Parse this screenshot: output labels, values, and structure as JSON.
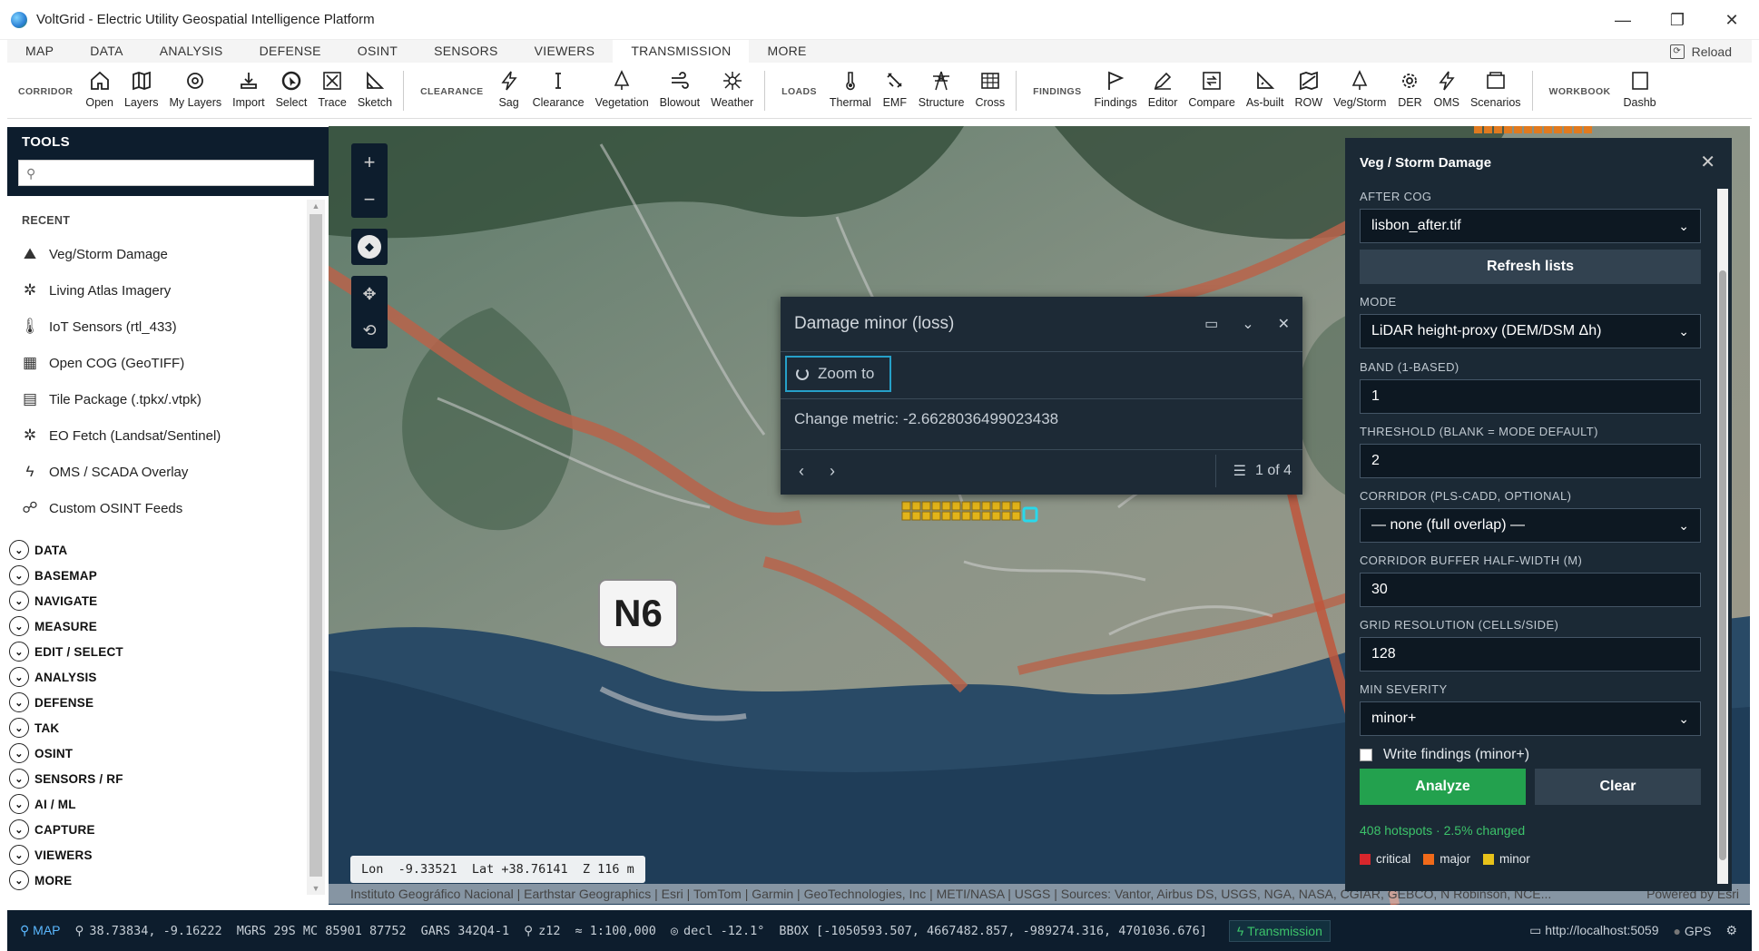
{
  "window": {
    "title": "VoltGrid - Electric Utility Geospatial Intelligence Platform",
    "minimize": "—",
    "restore": "❐",
    "close": "✕"
  },
  "menu": {
    "items": [
      "MAP",
      "DATA",
      "ANALYSIS",
      "DEFENSE",
      "OSINT",
      "SENSORS",
      "VIEWERS",
      "TRANSMISSION",
      "MORE"
    ],
    "active": "TRANSMISSION",
    "reload": "Reload"
  },
  "toolbar": {
    "corridor_label": "CORRIDOR",
    "corridor": [
      "Open",
      "Layers",
      "My Layers",
      "Import",
      "Select",
      "Trace",
      "Sketch"
    ],
    "clearance_label": "CLEARANCE",
    "clearance": [
      "Sag",
      "Clearance",
      "Vegetation",
      "Blowout",
      "Weather"
    ],
    "loads_label": "LOADS",
    "loads": [
      "Thermal",
      "EMF",
      "Structure",
      "Cross"
    ],
    "findings_label": "FINDINGS",
    "findings": [
      "Findings",
      "Editor",
      "Compare",
      "As-built",
      "ROW",
      "Veg/Storm",
      "DER",
      "OMS",
      "Scenarios"
    ],
    "workbook_label": "WORKBOOK",
    "workbook": [
      "Dashb"
    ]
  },
  "sidebar": {
    "title": "TOOLS",
    "search_placeholder": "",
    "recent_label": "RECENT",
    "recent": [
      {
        "label": "Veg/Storm Damage",
        "icon": "tree-icon"
      },
      {
        "label": "Living Atlas Imagery",
        "icon": "satellite-icon"
      },
      {
        "label": "IoT Sensors (rtl_433)",
        "icon": "thermometer-icon"
      },
      {
        "label": "Open COG (GeoTIFF)",
        "icon": "map-icon"
      },
      {
        "label": "Tile Package (.tpkx/.vtpk)",
        "icon": "package-map-icon"
      },
      {
        "label": "EO Fetch (Landsat/Sentinel)",
        "icon": "satellite-icon"
      },
      {
        "label": "OMS / SCADA Overlay",
        "icon": "bolt-icon"
      },
      {
        "label": "Custom OSINT Feeds",
        "icon": "feed-icon"
      }
    ],
    "categories": [
      "DATA",
      "BASEMAP",
      "NAVIGATE",
      "MEASURE",
      "EDIT / SELECT",
      "ANALYSIS",
      "DEFENSE",
      "TAK",
      "OSINT",
      "SENSORS / RF",
      "AI / ML",
      "CAPTURE",
      "VIEWERS",
      "MORE"
    ]
  },
  "map": {
    "road_label": "N6",
    "attribution": "Instituto Geográfico Nacional | Earthstar Geographics | Esri | TomTom | Garmin | GeoTechnologies, Inc | METI/NASA | USGS | Sources: Vantor, Airbus DS, USGS, NGA, NASA, CGIAR, GEBCO, N Robinson, NCE...",
    "powered_by": "Powered by Esri",
    "readout": "Lon  -9.33521  Lat +38.76141  Z 116 m",
    "zoom_in": "+",
    "zoom_out": "−"
  },
  "popup": {
    "title": "Damage minor (loss)",
    "zoom_to": "Zoom to",
    "metric": "Change metric: -2.6628036499023438",
    "count": "1 of 4",
    "prev": "‹",
    "next": "›"
  },
  "panel": {
    "title": "Veg / Storm Damage",
    "after_cog_label": "AFTER COG",
    "after_cog_value": "lisbon_after.tif",
    "refresh_label": "Refresh lists",
    "mode_label": "MODE",
    "mode_value": "LiDAR height-proxy (DEM/DSM Δh)",
    "band_label": "BAND (1-BASED)",
    "band_value": "1",
    "threshold_label": "THRESHOLD (BLANK = MODE DEFAULT)",
    "threshold_value": "2",
    "corridor_label": "CORRIDOR (PLS-CADD, OPTIONAL)",
    "corridor_value": "— none (full overlap) —",
    "buffer_label": "CORRIDOR BUFFER HALF-WIDTH (M)",
    "buffer_value": "30",
    "grid_label": "GRID RESOLUTION (CELLS/SIDE)",
    "grid_value": "128",
    "severity_label": "MIN SEVERITY",
    "severity_value": "minor+",
    "write_label": "Write findings (minor+)",
    "analyze_label": "Analyze",
    "clear_label": "Clear",
    "status": "408 hotspots · 2.5% changed",
    "legend": [
      {
        "label": "critical",
        "color": "#d8262c"
      },
      {
        "label": "major",
        "color": "#f06a1a"
      },
      {
        "label": "minor",
        "color": "#e8c21a"
      }
    ]
  },
  "statusbar": {
    "map_label": "MAP",
    "coords": "38.73834, -9.16222",
    "mgrs": "MGRS 29S MC 85901 87752",
    "gars": "GARS 342Q4-1",
    "zoom": "z12",
    "scale": "≈ 1:100,000",
    "decl": "decl -12.1°",
    "bbox": "BBOX [-1050593.507, 4667482.857, -989274.316, 4701036.676]",
    "transmission": "Transmission",
    "server": "http://localhost:5059",
    "gps": "GPS"
  },
  "colors": {
    "accent": "#26a0c8",
    "panel_bg": "#1b2935",
    "header_bg": "#0d1d2d",
    "analyze": "#23a14e",
    "status_green": "#3cc36a"
  }
}
